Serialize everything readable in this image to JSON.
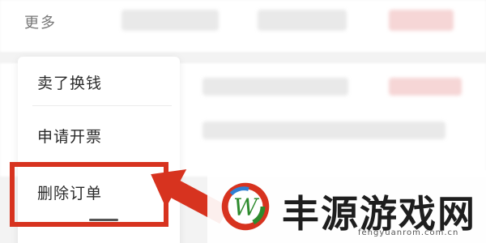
{
  "header": {
    "more_label": "更多"
  },
  "menu": {
    "items": [
      {
        "label": "卖了换钱"
      },
      {
        "label": "申请开票"
      },
      {
        "label": "删除订单"
      }
    ],
    "highlighted_index": 2
  },
  "watermark": {
    "title": "丰源游戏网",
    "url": "fengyuanrom.com.cn",
    "logo_letter": "W"
  },
  "colors": {
    "highlight": "#d7331f",
    "logo_red": "#d7331f",
    "logo_green": "#2e8b2e",
    "logo_blue": "#2f7fd3"
  },
  "icons": {
    "arrow": "arrow-left-icon",
    "logo": "site-logo-icon"
  }
}
